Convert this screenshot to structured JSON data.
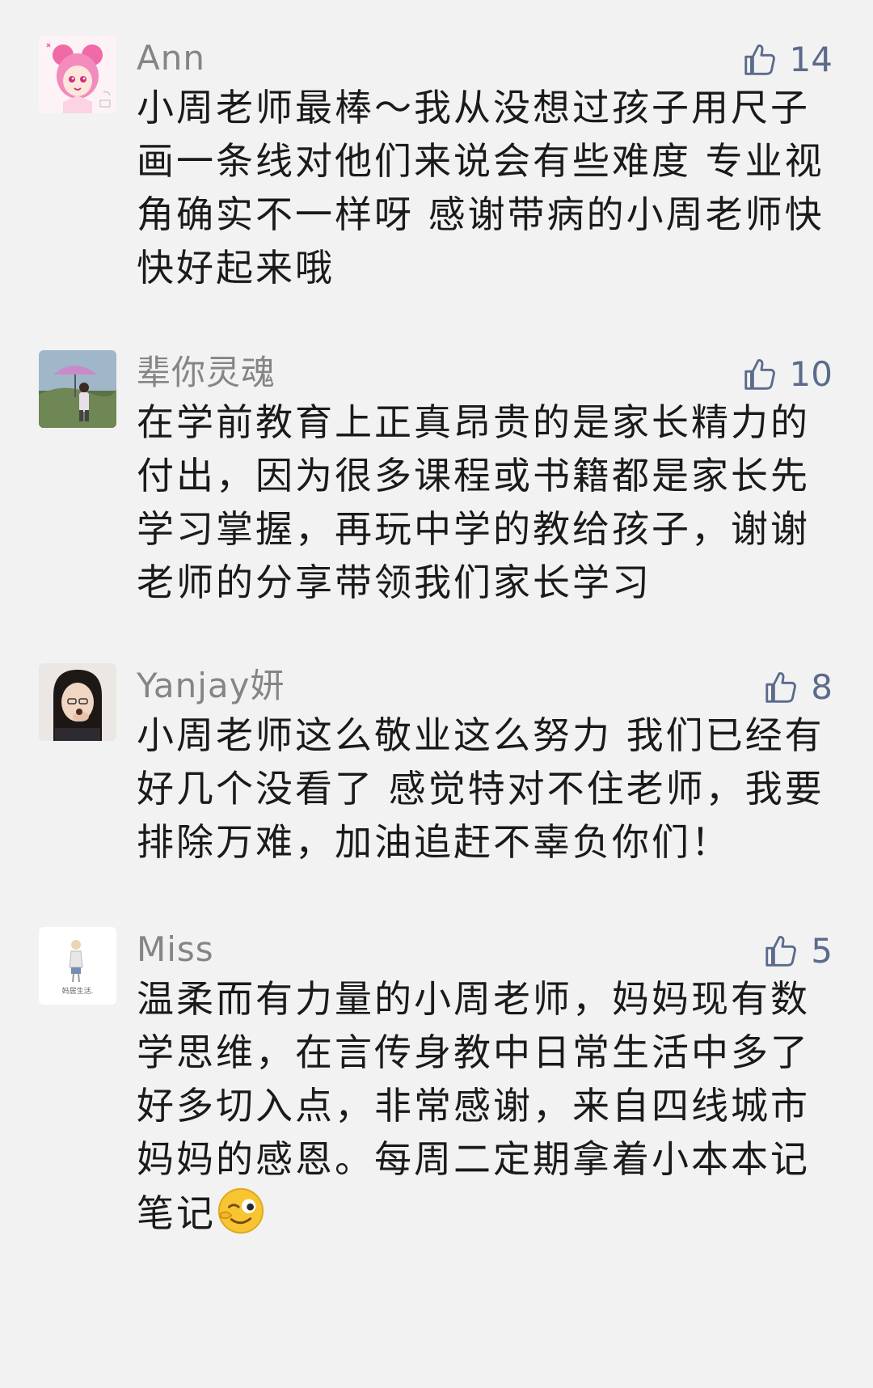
{
  "comments": [
    {
      "username": "Ann",
      "likes": "14",
      "text": "小周老师最棒～我从没想过孩子用尺子画一条线对他们来说会有些难度 专业视角确实不一样呀 感谢带病的小周老师快快好起来哦"
    },
    {
      "username": "辈你灵魂",
      "likes": "10",
      "text": "在学前教育上正真昂贵的是家长精力的付出，因为很多课程或书籍都是家长先学习掌握，再玩中学的教给孩子，谢谢老师的分享带领我们家长学习"
    },
    {
      "username": "Yanjay妍",
      "likes": "8",
      "text": "小周老师这么敬业这么努力 我们已经有好几个没看了 感觉特对不住老师，我要排除万难，加油追赶不辜负你们！"
    },
    {
      "username": "Miss",
      "likes": "5",
      "text": "温柔而有力量的小周老师，妈妈现有数学思维，在言传身教中日常生活中多了好多切入点，非常感谢，来自四线城市妈妈的感恩。每周二定期拿着小本本记笔记",
      "emoji": "wink-emoji",
      "avatar_text": "妈居生活."
    }
  ],
  "colors": {
    "background": "#f2f2f2",
    "username": "#858585",
    "like": "#5b6b8c",
    "text": "#1a1a1a"
  },
  "icons": {
    "like": "thumbs-up-icon"
  }
}
